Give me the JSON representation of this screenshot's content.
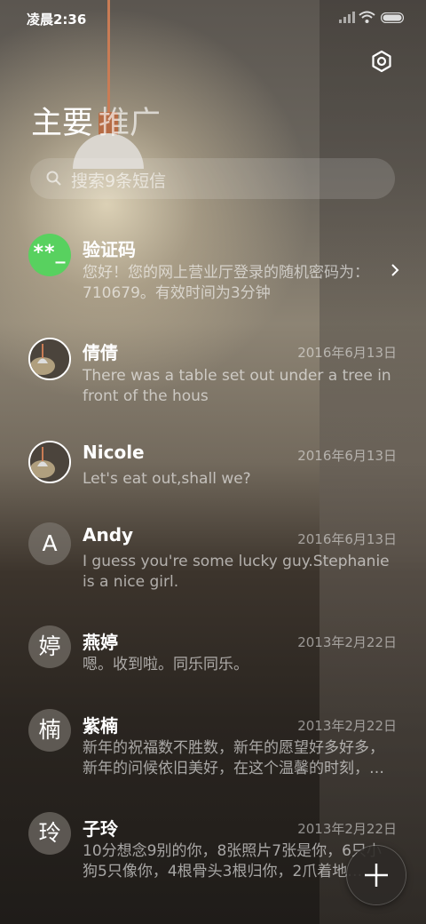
{
  "status_bar": {
    "time": "凌晨2:36"
  },
  "tabs": {
    "primary": "主要",
    "promotions": "推广"
  },
  "search": {
    "placeholder": "搜索9条短信"
  },
  "threads": [
    {
      "name": "验证码",
      "avatar_text": "**_",
      "avatar_color": "#58d15f",
      "date": "",
      "preview": "您好！您的网上营业厅登录的随机密码为：710679。有效时间为3分钟"
    },
    {
      "name": "倩倩",
      "avatar": "photo",
      "date": "2016年6月13日",
      "preview": "There was a table set out under a tree in front of the hous"
    },
    {
      "name": "Nicole",
      "avatar": "photo",
      "date": "2016年6月13日",
      "preview": "Let's eat out,shall we?"
    },
    {
      "name": "Andy",
      "avatar_text": "A",
      "date": "2016年6月13日",
      "preview": "I guess you're some lucky guy.Stephanie is a nice girl."
    },
    {
      "name": "燕婷",
      "avatar_text": "婷",
      "date": "2013年2月22日",
      "preview": "嗯。收到啦。同乐同乐。"
    },
    {
      "name": "紫楠",
      "avatar_text": "楠",
      "date": "2013年2月22日",
      "preview": "新年的祝福数不胜数，新年的愿望好多好多，新年的问候依旧美好，在这个温馨的时刻，…"
    },
    {
      "name": "子玲",
      "avatar_text": "玲",
      "date": "2013年2月22日",
      "preview": "10分想念9别的你，8张照片7张是你，6只小狗5只像你，4根骨头3根归你，2爪着地…"
    }
  ],
  "icons": {
    "settings": "gear-icon",
    "search": "search-icon",
    "compose": "plus-icon",
    "open_thread": "chevron-right-icon"
  }
}
